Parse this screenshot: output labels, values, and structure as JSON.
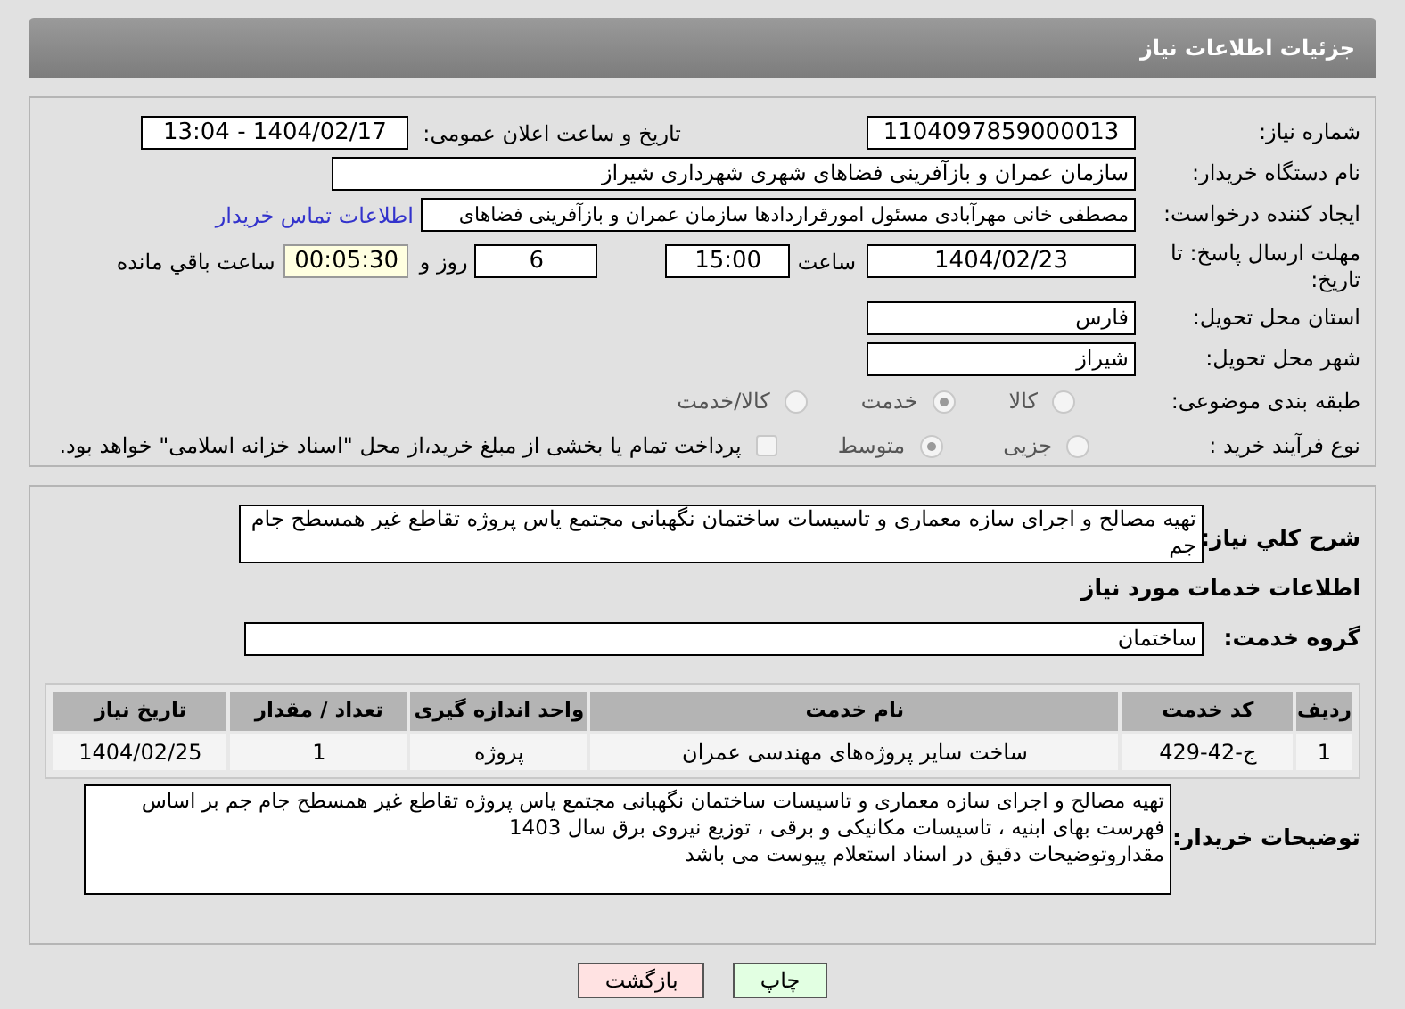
{
  "header": {
    "title": "جزئیات اطلاعات نیاز"
  },
  "details": {
    "need_number": {
      "label": "شماره نیاز:",
      "value": "1104097859000013"
    },
    "announce": {
      "label": "تاریخ و ساعت اعلان عمومی:",
      "value": "1404/02/17 - 13:04"
    },
    "buyer": {
      "label": "نام دستگاه خریدار:",
      "value": "سازمان عمران و بازآفرینی فضاهای شهری شهرداری شیراز"
    },
    "creator": {
      "label": "ایجاد کننده درخواست:",
      "value": "مصطفی خانی مهرآبادی مسئول امورقراردادها سازمان عمران و بازآفرینی فضاهای",
      "link": "اطلاعات تماس خریدار"
    },
    "deadline": {
      "label": "مهلت ارسال پاسخ: تا تاریخ:",
      "date": "1404/02/23",
      "time_label": "ساعت",
      "time": "15:00",
      "days": "6",
      "days_label": "روز و",
      "remaining": "00:05:30",
      "remaining_label": "ساعت باقي مانده"
    },
    "province": {
      "label": "استان محل تحویل:",
      "value": "فارس"
    },
    "city": {
      "label": "شهر محل تحویل:",
      "value": "شیراز"
    },
    "category": {
      "label": "طبقه بندی موضوعی:",
      "options": [
        {
          "label": "کالا",
          "selected": false
        },
        {
          "label": "خدمت",
          "selected": true
        },
        {
          "label": "کالا/خدمت",
          "selected": false
        }
      ]
    },
    "process": {
      "label": "نوع فرآیند خرید :",
      "options": [
        {
          "label": "جزیی",
          "selected": false
        },
        {
          "label": "متوسط",
          "selected": true
        }
      ],
      "treasury": {
        "label": "پرداخت تمام یا بخشی از مبلغ خرید،از محل \"اسناد خزانه اسلامی\" خواهد بود.",
        "checked": false
      }
    }
  },
  "summary": {
    "label": "شرح کلي نياز:",
    "value": "تهیه مصالح و اجرای سازه معماری و تاسیسات ساختمان نگهبانی مجتمع یاس پروژه تقاطع غیر همسطح جام جم",
    "services_title": "اطلاعات خدمات مورد نیاز",
    "group": {
      "label": "گروه خدمت:",
      "value": "ساختمان"
    },
    "table": {
      "columns": [
        "ردیف",
        "کد خدمت",
        "نام خدمت",
        "واحد اندازه گیری",
        "تعداد / مقدار",
        "تاریخ نیاز"
      ],
      "rows": [
        [
          "1",
          "ج-42-429",
          "ساخت سایر پروژه‌های مهندسی عمران",
          "پروژه",
          "1",
          "1404/02/25"
        ]
      ]
    },
    "notes": {
      "label": "توضیحات خریدار:",
      "value": "تهیه مصالح و اجرای سازه معماری و تاسیسات ساختمان نگهبانی مجتمع یاس پروژه تقاطع غیر همسطح جام جم بر اساس فهرست بهای ابنیه ، تاسیسات مکانیکی و برقی ، توزیع نیروی برق سال 1403\nمقداروتوضیحات دقیق در اسناد استعلام پیوست می باشد"
    }
  },
  "buttons": [
    {
      "label": "چاپ",
      "kind": "print"
    },
    {
      "label": "بازگشت",
      "kind": "back"
    }
  ]
}
